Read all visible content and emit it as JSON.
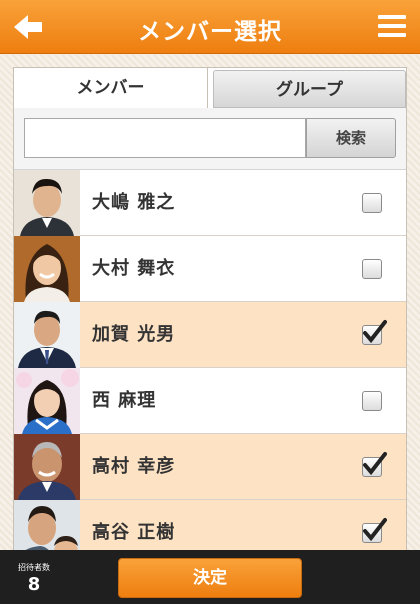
{
  "header": {
    "title": "メンバー選択",
    "back_icon": "back-arrow-icon",
    "menu_icon": "hamburger-menu-icon",
    "color": "#f28a1c"
  },
  "tabs": [
    {
      "label": "メンバー",
      "active": true
    },
    {
      "label": "グループ",
      "active": false
    }
  ],
  "search": {
    "value": "",
    "placeholder": "",
    "button_label": "検索"
  },
  "members": [
    {
      "name": "大嶋 雅之",
      "checked": false
    },
    {
      "name": "大村 舞衣",
      "checked": false
    },
    {
      "name": "加賀 光男",
      "checked": true
    },
    {
      "name": "西 麻理",
      "checked": false
    },
    {
      "name": "高村 幸彦",
      "checked": true
    },
    {
      "name": "高谷 正樹",
      "checked": true
    }
  ],
  "footer": {
    "invite_label": "招待者数",
    "invite_count": "8",
    "submit_label": "決定"
  },
  "colors": {
    "accent": "#f28a1c",
    "checked_row": "#fde2c4",
    "footer_bg": "#1f1f1f"
  }
}
